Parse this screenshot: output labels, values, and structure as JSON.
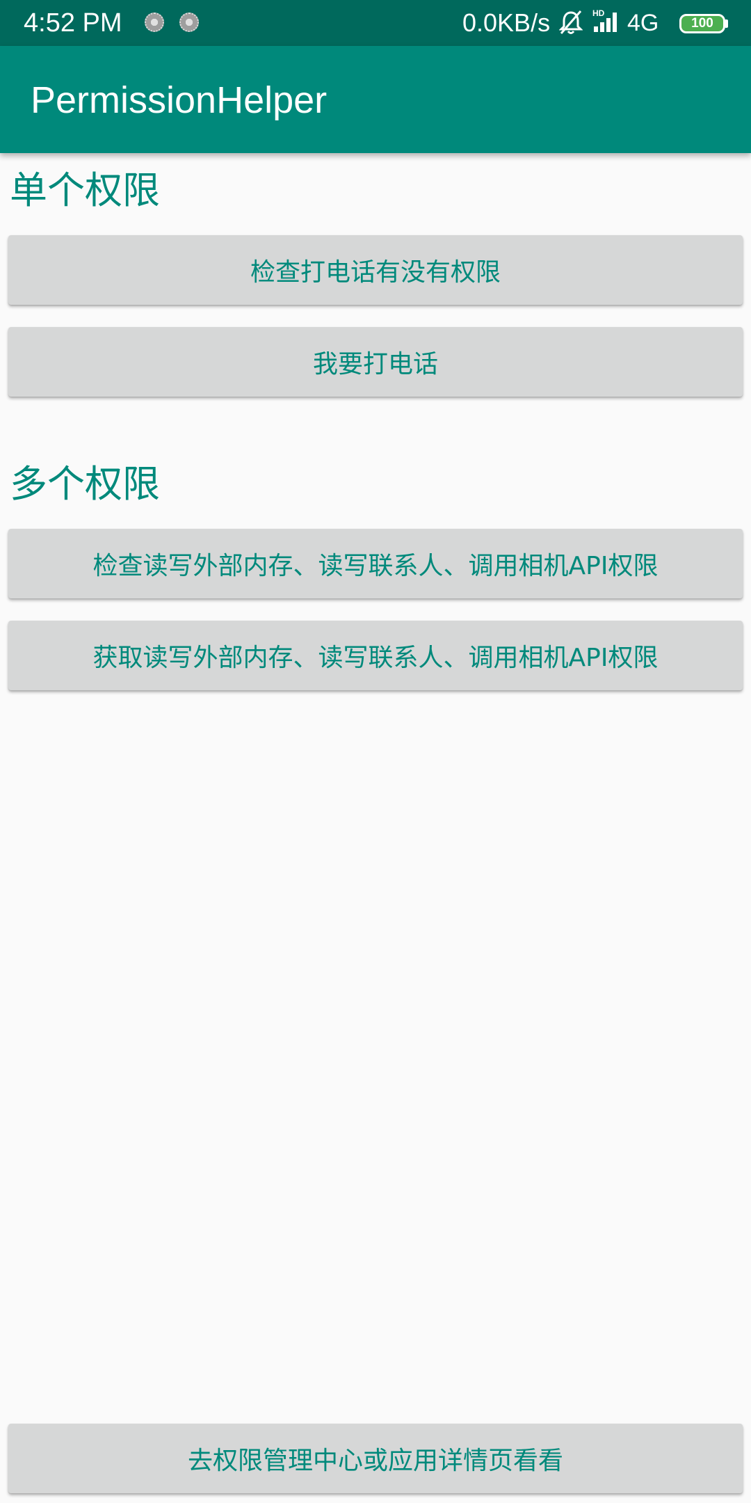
{
  "status_bar": {
    "time": "4:52  PM",
    "network_speed": "0.0KB/s",
    "network_type": "4G",
    "battery_level": "100",
    "icons": [
      "notification-dot-icon",
      "notification-dot-icon",
      "mute-bell-icon",
      "hd-signal-icon",
      "battery-icon"
    ]
  },
  "app_bar": {
    "title": "PermissionHelper"
  },
  "single_section": {
    "title": "单个权限",
    "check_call_label": "检查打电话有没有权限",
    "make_call_label": "我要打电话"
  },
  "multi_section": {
    "title": "多个权限",
    "check_multi_label": "检查读写外部内存、读写联系人、调用相机API权限",
    "request_multi_label": "获取读写外部内存、读写联系人、调用相机API权限"
  },
  "footer": {
    "settings_label": "去权限管理中心或应用详情页看看"
  },
  "colors": {
    "status_bar": "#00695c",
    "app_bar": "#00897b",
    "accent_text": "#00897b",
    "button_bg": "#d6d7d7",
    "background": "#fafafa"
  }
}
